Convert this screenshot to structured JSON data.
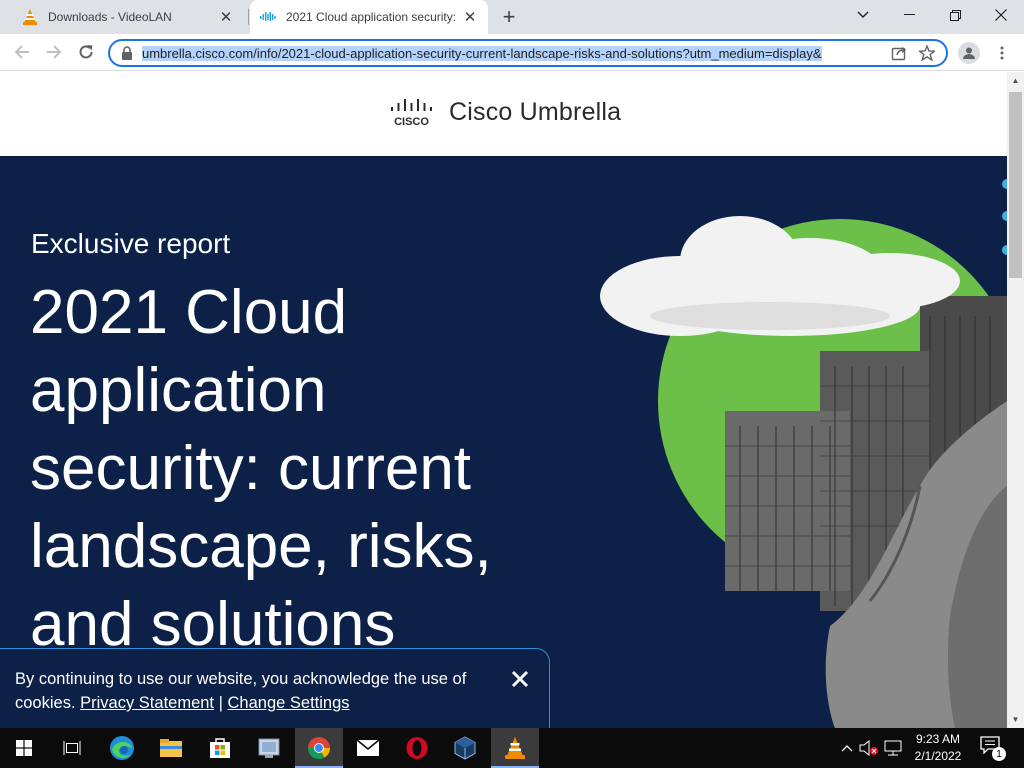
{
  "browser": {
    "tabs": [
      {
        "title": "Downloads - VideoLAN",
        "favicon": "vlc-cone-icon",
        "active": false
      },
      {
        "title": "2021 Cloud application security:",
        "favicon": "cisco-icon",
        "active": true
      }
    ],
    "new_tab_label": "+",
    "url_text": "umbrella.cisco.com/info/2021-cloud-application-security-current-landscape-risks-and-solutions?utm_medium=display&",
    "accent": "#1a73e8"
  },
  "page": {
    "header": {
      "logo_wordmark": "CISCO",
      "brand": "Cisco Umbrella"
    },
    "hero": {
      "kicker": "Exclusive report",
      "headline": "2021 Cloud application security: current landscape, risks, and solutions",
      "background": "#0d2148",
      "accent_circle": "#6cc04a"
    },
    "cookie_banner": {
      "message": "By continuing to use our website, you acknowledge the use of cookies.",
      "privacy_link": "Privacy Statement",
      "separator": "|",
      "settings_link": "Change Settings"
    }
  },
  "taskbar": {
    "pinned": [
      "windows-start-icon",
      "task-view-icon",
      "edge-icon",
      "file-explorer-icon",
      "store-icon",
      "app-icon",
      "chrome-icon",
      "mail-icon",
      "opera-icon",
      "virtualbox-icon",
      "vlc-icon"
    ],
    "time": "9:23 AM",
    "date": "2/1/2022",
    "notification_count": "1"
  }
}
